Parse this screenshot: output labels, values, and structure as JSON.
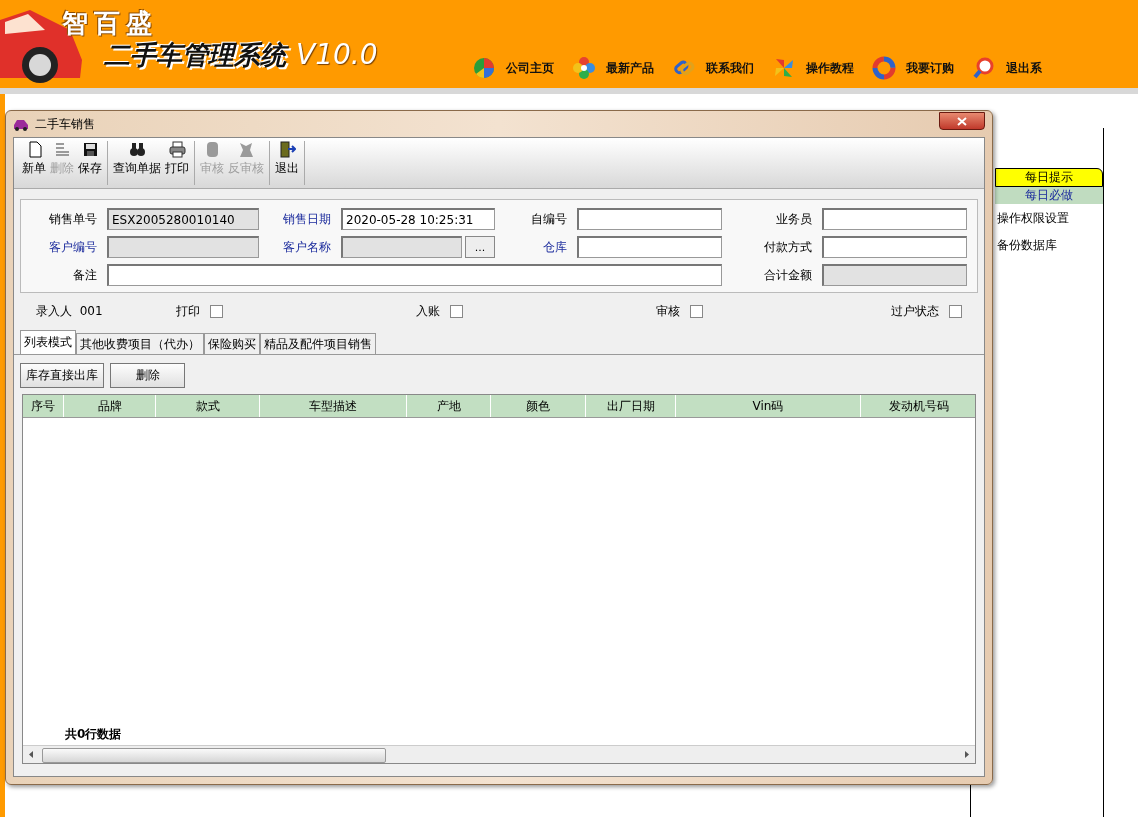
{
  "app": {
    "logo": "智百盛",
    "title": "二手车管理系统",
    "version": "V10.0"
  },
  "nav": [
    {
      "label": "公司主页"
    },
    {
      "label": "最新产品"
    },
    {
      "label": "联系我们"
    },
    {
      "label": "操作教程"
    },
    {
      "label": "我要订购"
    },
    {
      "label": "退出系"
    }
  ],
  "side_panel": {
    "tabs": [
      {
        "label": "每日提示",
        "selected": true
      },
      {
        "label": "每日必做",
        "selected": false
      }
    ],
    "items": [
      "操作权限设置",
      "备份数据库"
    ]
  },
  "dialog": {
    "title": "二手车销售",
    "toolbar": [
      {
        "label": "新单",
        "disabled": false
      },
      {
        "label": "删除",
        "disabled": true
      },
      {
        "label": "保存",
        "disabled": false
      },
      {
        "label": "查询单据",
        "disabled": false
      },
      {
        "label": "打印",
        "disabled": false
      },
      {
        "label": "审核",
        "disabled": true
      },
      {
        "label": "反审核",
        "disabled": true
      },
      {
        "label": "退出",
        "disabled": false
      }
    ],
    "fields": [
      {
        "label": "销售单号",
        "kind": "text",
        "highlighted": false,
        "readonly": true,
        "value": "ESX2005280010140"
      },
      {
        "label": "销售日期",
        "kind": "text",
        "highlighted": true,
        "readonly": false,
        "value": "2020-05-28 10:25:31"
      },
      {
        "label": "自编号",
        "kind": "text",
        "highlighted": false,
        "readonly": false
      },
      {
        "label": "业务员",
        "kind": "text",
        "highlighted": false,
        "readonly": false
      },
      {
        "label": "客户编号",
        "kind": "text",
        "highlighted": true,
        "readonly": true
      },
      {
        "label": "客户名称",
        "kind": "lookup",
        "highlighted": true,
        "readonly": true,
        "button": "..."
      },
      {
        "label": "仓库",
        "kind": "text",
        "highlighted": true,
        "readonly": false
      },
      {
        "label": "付款方式",
        "kind": "text",
        "highlighted": false,
        "readonly": false
      },
      {
        "label": "备注",
        "kind": "memo",
        "highlighted": false,
        "readonly": false
      },
      {
        "label": "合计金额",
        "kind": "text",
        "highlighted": false,
        "readonly": true
      }
    ],
    "entered_by": {
      "label": "录入人",
      "value": "001"
    },
    "checks": [
      {
        "label": "打印",
        "checked": false
      },
      {
        "label": "入账",
        "checked": false
      },
      {
        "label": "审核",
        "checked": false
      },
      {
        "label": "过户状态",
        "checked": false
      }
    ],
    "tabs": [
      {
        "label": "列表模式",
        "selected": true
      },
      {
        "label": "其他收费项目（代办）",
        "selected": false
      },
      {
        "label": "保险购买",
        "selected": false
      },
      {
        "label": "精品及配件项目销售",
        "selected": false
      }
    ],
    "actions": [
      "库存直接出库",
      "删除"
    ],
    "columns": [
      "序号",
      "品牌",
      "款式",
      "车型描述",
      "产地",
      "颜色",
      "出厂日期",
      "Vin码",
      "发动机号码"
    ],
    "footer": "共0行数据"
  }
}
